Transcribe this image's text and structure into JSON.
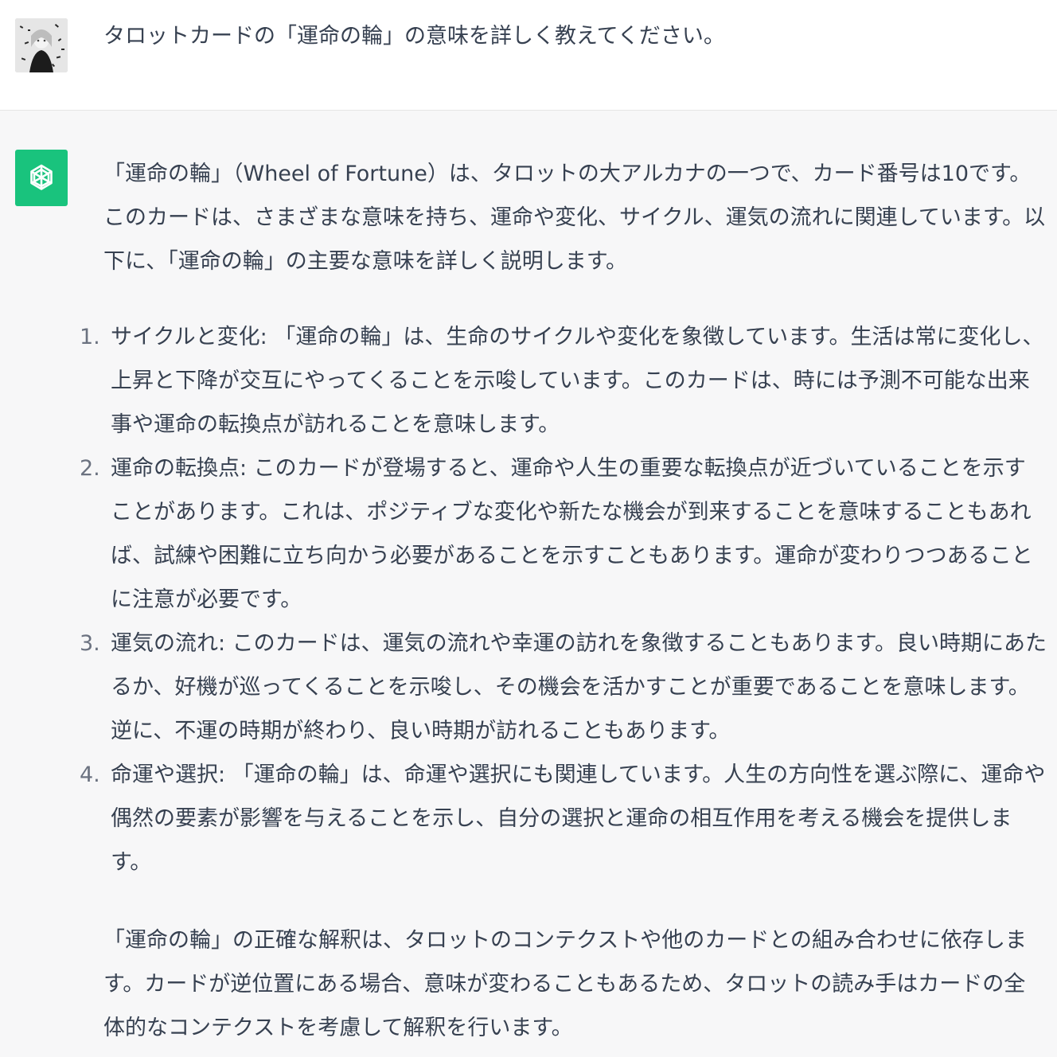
{
  "user": {
    "avatar": "user-avatar-image",
    "message": "タロットカードの「運命の輪」の意味を詳しく教えてください。"
  },
  "assistant": {
    "icon": "openai-logo-icon",
    "intro": "「運命の輪」（Wheel of Fortune）は、タロットの大アルカナの一つで、カード番号は10です。このカードは、さまざまな意味を持ち、運命や変化、サイクル、運気の流れに関連しています。以下に、「運命の輪」の主要な意味を詳しく説明します。",
    "items": [
      {
        "number": "1.",
        "text": "サイクルと変化: 「運命の輪」は、生命のサイクルや変化を象徴しています。生活は常に変化し、上昇と下降が交互にやってくることを示唆しています。このカードは、時には予測不可能な出来事や運命の転換点が訪れることを意味します。"
      },
      {
        "number": "2.",
        "text": "運命の転換点: このカードが登場すると、運命や人生の重要な転換点が近づいていることを示すことがあります。これは、ポジティブな変化や新たな機会が到来することを意味することもあれば、試練や困難に立ち向かう必要があることを示すこともあります。運命が変わりつつあることに注意が必要です。"
      },
      {
        "number": "3.",
        "text": "運気の流れ: このカードは、運気の流れや幸運の訪れを象徴することもあります。良い時期にあたるか、好機が巡ってくることを示唆し、その機会を活かすことが重要であることを意味します。逆に、不運の時期が終わり、良い時期が訪れることもあります。"
      },
      {
        "number": "4.",
        "text": "命運や選択: 「運命の輪」は、命運や選択にも関連しています。人生の方向性を選ぶ際に、運命や偶然の要素が影響を与えることを示し、自分の選択と運命の相互作用を考える機会を提供します。"
      }
    ],
    "conclusion": "「運命の輪」の正確な解釈は、タロットのコンテクストや他のカードとの組み合わせに依存します。カードが逆位置にある場合、意味が変わることもあるため、タロットの読み手はカードの全体的なコンテクストを考慮して解釈を行います。"
  },
  "colors": {
    "assistant_icon_bg": "#19c37d",
    "text": "#374151",
    "list_number": "#6b7280",
    "assistant_bg": "#f7f7f8",
    "user_bg": "#ffffff"
  }
}
